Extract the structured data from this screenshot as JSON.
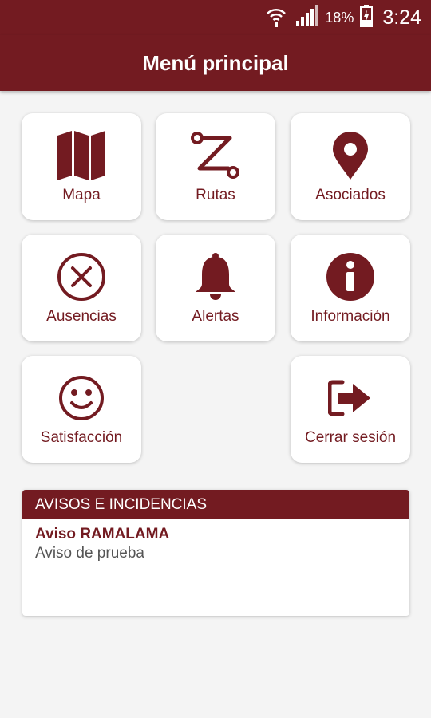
{
  "status_bar": {
    "battery": "18%",
    "time": "3:24"
  },
  "app_bar": {
    "title": "Menú principal"
  },
  "menu": {
    "items": [
      {
        "label": "Mapa",
        "icon": "map-icon"
      },
      {
        "label": "Rutas",
        "icon": "route-icon"
      },
      {
        "label": "Asociados",
        "icon": "location-pin-icon"
      },
      {
        "label": "Ausencias",
        "icon": "close-circle-icon"
      },
      {
        "label": "Alertas",
        "icon": "bell-icon"
      },
      {
        "label": "Información",
        "icon": "info-icon"
      },
      {
        "label": "Satisfacción",
        "icon": "smiley-icon"
      },
      {
        "label": "Cerrar sesión",
        "icon": "logout-icon"
      }
    ]
  },
  "notices": {
    "header": "AVISOS E INCIDENCIAS",
    "items": [
      {
        "title": "Aviso RAMALAMA",
        "description": "Aviso de prueba"
      }
    ]
  },
  "colors": {
    "primary": "#731b21",
    "background": "#f4f4f4"
  }
}
